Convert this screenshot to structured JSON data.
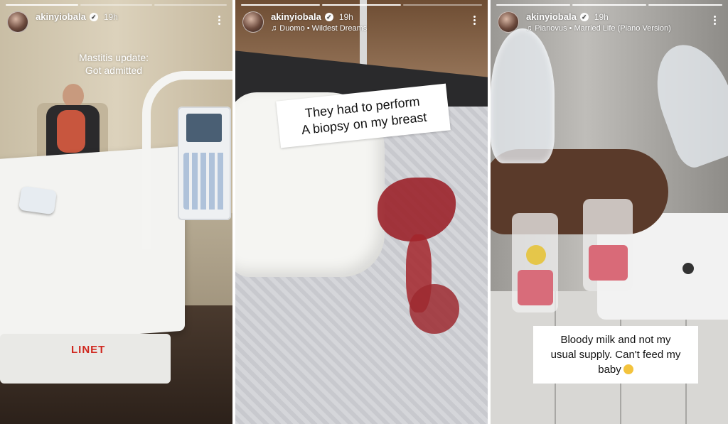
{
  "stories": [
    {
      "username": "akinyiobala",
      "time": "19h",
      "music": "",
      "caption_line1": "Mastitis update:",
      "caption_line2": "Got admitted",
      "bed_brand": "LINET"
    },
    {
      "username": "akinyiobala",
      "time": "19h",
      "music": "Duomo • Wildest Dreams",
      "caption_line1": "They had to perform",
      "caption_line2": "A biopsy on my breast"
    },
    {
      "username": "akinyiobala",
      "time": "19h",
      "music": "Pianovus • Married Life (Piano Version)",
      "caption_line1": "Bloody milk and not my",
      "caption_line2": "usual supply. Can't feed my",
      "caption_line3": "baby"
    }
  ],
  "icons": {
    "verified": "verified-badge-icon",
    "music": "music-note-icon",
    "more": "more-options-icon",
    "emoji": "sad-face-emoji-icon"
  },
  "colors": {
    "text": "#ffffff",
    "caption_bg": "#ffffff",
    "blood": "#9a1e26"
  }
}
